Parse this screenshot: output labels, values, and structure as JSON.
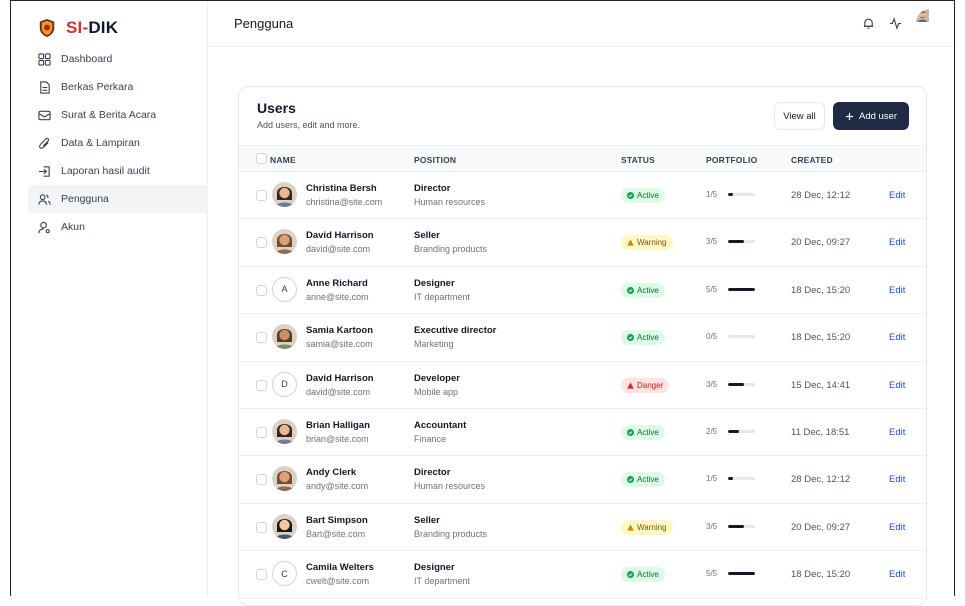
{
  "brand": {
    "part1": "SI-",
    "part2": "DIK"
  },
  "sidebar": {
    "items": [
      {
        "label": "Dashboard",
        "icon": "grid-icon"
      },
      {
        "label": "Berkas Perkara",
        "icon": "file-icon"
      },
      {
        "label": "Surat & Berita Acara",
        "icon": "mail-icon"
      },
      {
        "label": "Data & Lampiran",
        "icon": "paperclip-icon"
      },
      {
        "label": "Laporan hasil audit",
        "icon": "login-icon"
      },
      {
        "label": "Pengguna",
        "icon": "users-icon",
        "active": true
      },
      {
        "label": "Akun",
        "icon": "user-icon"
      }
    ]
  },
  "header": {
    "title": "Pengguna"
  },
  "card": {
    "title": "Users",
    "subtitle": "Add users, edit and more.",
    "view_all_label": "View all",
    "add_user_label": "Add user",
    "columns": {
      "name": "NAME",
      "position": "POSITION",
      "status": "STATUS",
      "portfolio": "PORTFOLIO",
      "created": "CREATED"
    }
  },
  "users": [
    {
      "name": "Christina Bersh",
      "email": "christina@site.com",
      "position": "Director",
      "department": "Human resources",
      "status": "Active",
      "status_kind": "active",
      "portfolio": "1/5",
      "portfolio_fraction": 0.2,
      "created": "28 Dec, 12:12",
      "edit": "Edit",
      "avatar": "photo"
    },
    {
      "name": "David Harrison",
      "email": "david@site.com",
      "position": "Seller",
      "department": "Branding products",
      "status": "Warning",
      "status_kind": "warning",
      "portfolio": "3/5",
      "portfolio_fraction": 0.6,
      "created": "20 Dec, 09:27",
      "edit": "Edit",
      "avatar": "photo"
    },
    {
      "name": "Anne Richard",
      "email": "anne@site.com",
      "position": "Designer",
      "department": "IT department",
      "status": "Active",
      "status_kind": "active",
      "portfolio": "5/5",
      "portfolio_fraction": 1.0,
      "created": "18 Dec, 15:20",
      "edit": "Edit",
      "avatar": "A"
    },
    {
      "name": "Samia Kartoon",
      "email": "samia@site.com",
      "position": "Executive director",
      "department": "Marketing",
      "status": "Active",
      "status_kind": "active",
      "portfolio": "0/5",
      "portfolio_fraction": 0.0,
      "created": "18 Dec, 15:20",
      "edit": "Edit",
      "avatar": "photo"
    },
    {
      "name": "David Harrison",
      "email": "david@site.com",
      "position": "Developer",
      "department": "Mobile app",
      "status": "Danger",
      "status_kind": "danger",
      "portfolio": "3/5",
      "portfolio_fraction": 0.6,
      "created": "15 Dec, 14:41",
      "edit": "Edit",
      "avatar": "D"
    },
    {
      "name": "Brian Halligan",
      "email": "brian@site.com",
      "position": "Accountant",
      "department": "Finance",
      "status": "Active",
      "status_kind": "active",
      "portfolio": "2/5",
      "portfolio_fraction": 0.4,
      "created": "11 Dec, 18:51",
      "edit": "Edit",
      "avatar": "photo"
    },
    {
      "name": "Andy Clerk",
      "email": "andy@site.com",
      "position": "Director",
      "department": "Human resources",
      "status": "Active",
      "status_kind": "active",
      "portfolio": "1/5",
      "portfolio_fraction": 0.2,
      "created": "28 Dec, 12:12",
      "edit": "Edit",
      "avatar": "photo"
    },
    {
      "name": "Bart Simpson",
      "email": "Bart@site.com",
      "position": "Seller",
      "department": "Branding products",
      "status": "Warning",
      "status_kind": "warning",
      "portfolio": "3/5",
      "portfolio_fraction": 0.6,
      "created": "20 Dec, 09:27",
      "edit": "Edit",
      "avatar": "photo"
    },
    {
      "name": "Camila Welters",
      "email": "cwelt@site.com",
      "position": "Designer",
      "department": "IT department",
      "status": "Active",
      "status_kind": "active",
      "portfolio": "5/5",
      "portfolio_fraction": 1.0,
      "created": "18 Dec, 15:20",
      "edit": "Edit",
      "avatar": "C"
    }
  ],
  "colors": {
    "brand_red": "#d32f2f",
    "primary_button": "#1f2a44",
    "link": "#1d4ed8"
  }
}
